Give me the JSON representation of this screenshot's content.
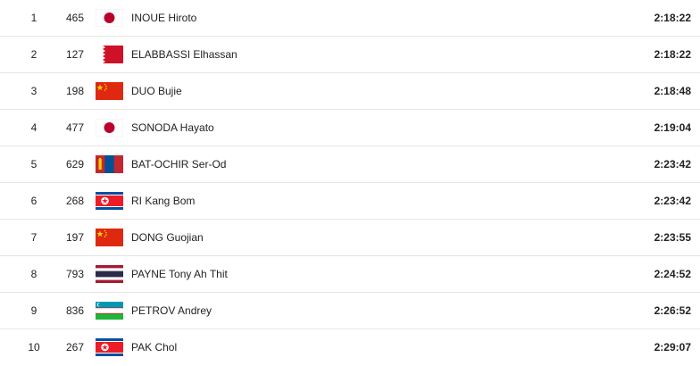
{
  "results": [
    {
      "rank": "1",
      "bib": "465",
      "flag": "japan-flag-icon",
      "name": "INOUE Hiroto",
      "time": "2:18:22"
    },
    {
      "rank": "2",
      "bib": "127",
      "flag": "bahrain-flag-icon",
      "name": "ELABBASSI Elhassan",
      "time": "2:18:22"
    },
    {
      "rank": "3",
      "bib": "198",
      "flag": "china-flag-icon",
      "name": "DUO Bujie",
      "time": "2:18:48"
    },
    {
      "rank": "4",
      "bib": "477",
      "flag": "japan-flag-icon",
      "name": "SONODA Hayato",
      "time": "2:19:04"
    },
    {
      "rank": "5",
      "bib": "629",
      "flag": "mongolia-flag-icon",
      "name": "BAT-OCHIR Ser-Od",
      "time": "2:23:42"
    },
    {
      "rank": "6",
      "bib": "268",
      "flag": "north-korea-flag-icon",
      "name": "RI Kang Bom",
      "time": "2:23:42"
    },
    {
      "rank": "7",
      "bib": "197",
      "flag": "china-flag-icon",
      "name": "DONG Guojian",
      "time": "2:23:55"
    },
    {
      "rank": "8",
      "bib": "793",
      "flag": "thailand-flag-icon",
      "name": "PAYNE Tony Ah Thit",
      "time": "2:24:52"
    },
    {
      "rank": "9",
      "bib": "836",
      "flag": "uzbekistan-flag-icon",
      "name": "PETROV Andrey",
      "time": "2:26:52"
    },
    {
      "rank": "10",
      "bib": "267",
      "flag": "north-korea-flag-icon",
      "name": "PAK Chol",
      "time": "2:29:07"
    }
  ]
}
